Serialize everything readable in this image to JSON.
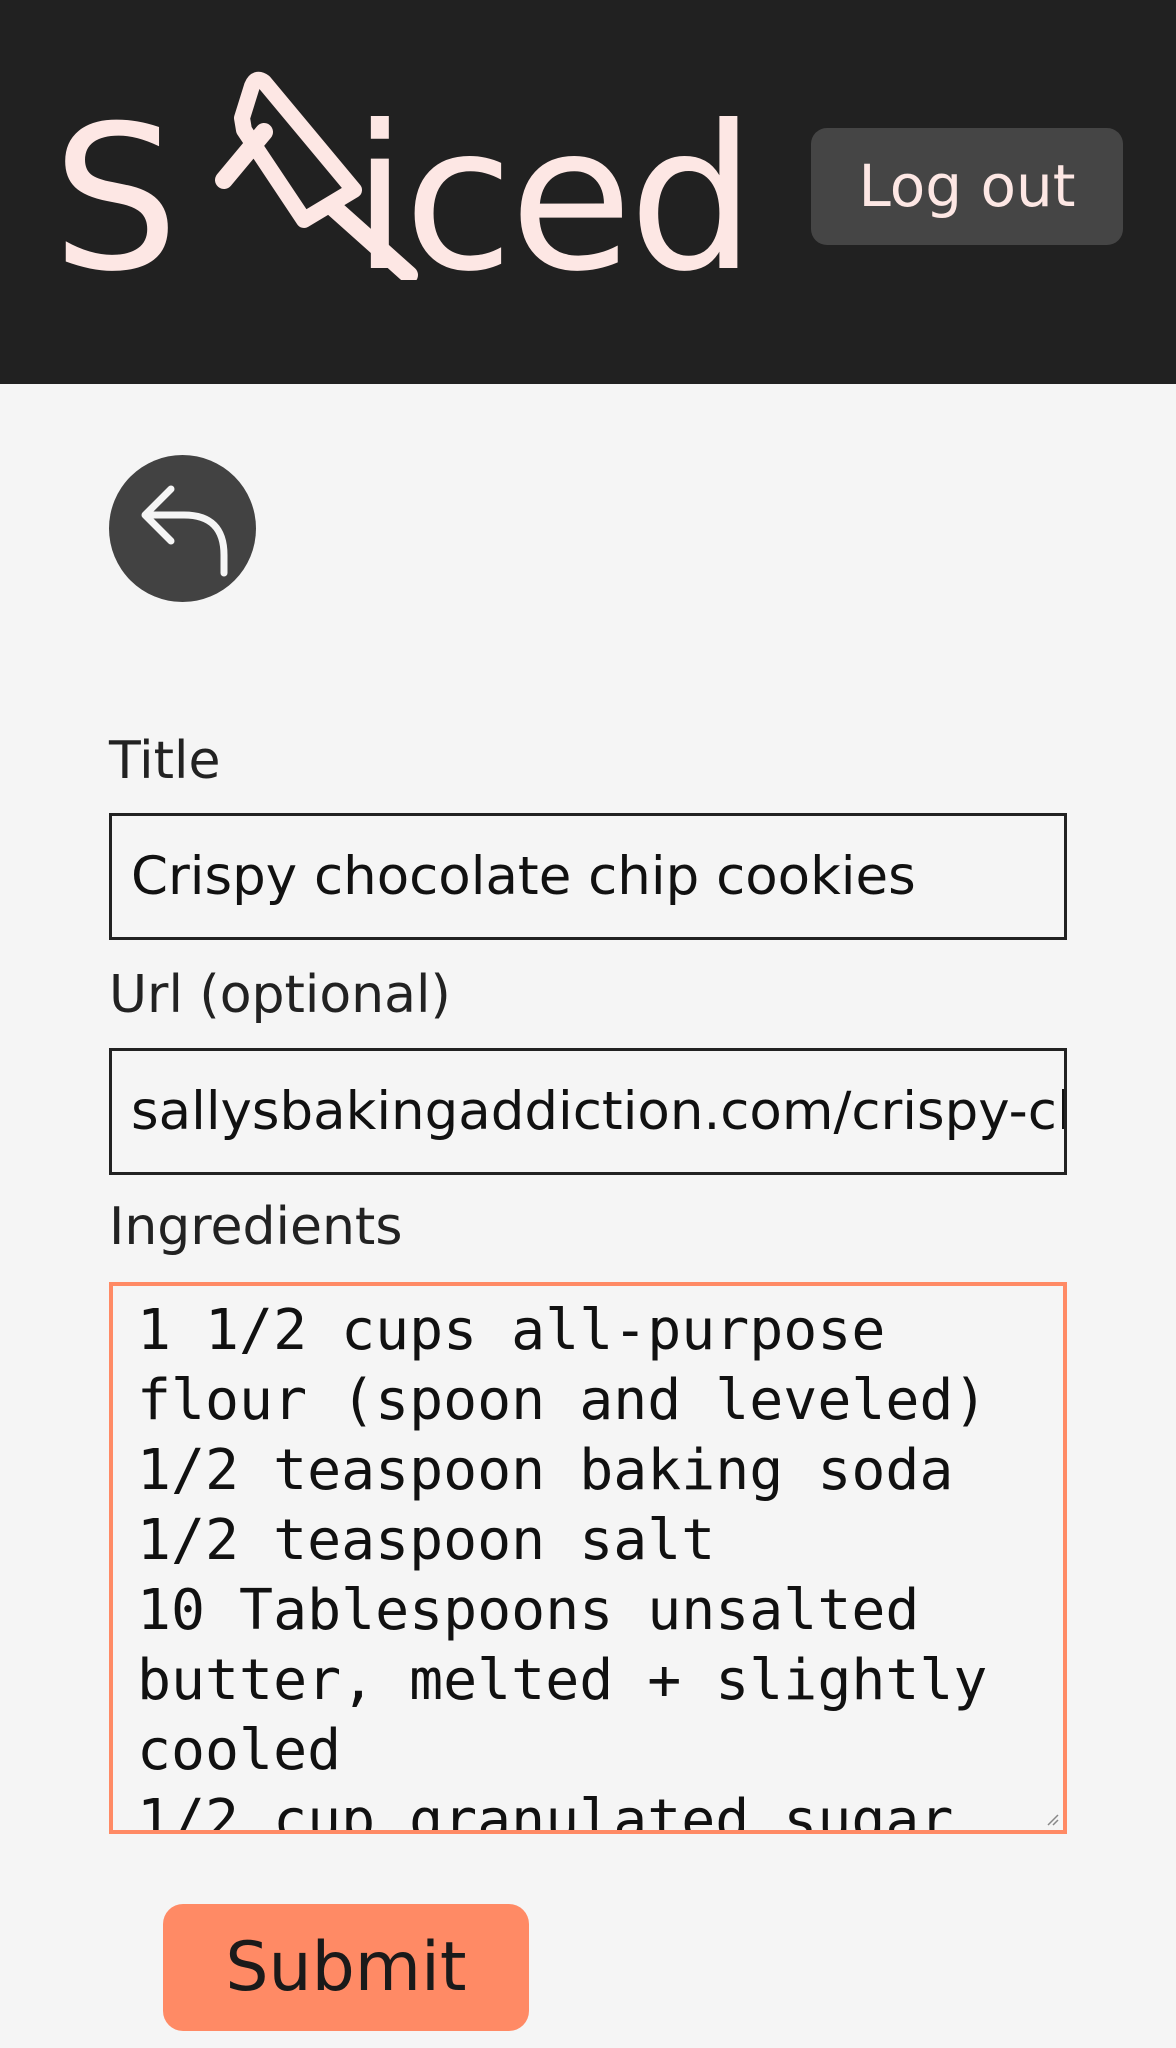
{
  "header": {
    "logo_first": "S",
    "logo_rest": "iced",
    "logout_label": "Log out",
    "logo_color": "#fde7e4",
    "background": "#212121"
  },
  "back_button": {
    "icon": "back-arrow-icon"
  },
  "form": {
    "title_label": "Title",
    "title_value": "Crispy chocolate chip cookies",
    "url_label": "Url (optional)",
    "url_value": "sallysbakingaddiction.com/crispy-cl",
    "ingredients_label": "Ingredients",
    "ingredients_value": "1 1/2 cups all-purpose\nflour (spoon and leveled)\n1/2 teaspoon baking soda\n1/2 teaspoon salt\n10 Tablespoons unsalted\nbutter, melted + slightly\ncooled\n1/2 cup granulated sugar",
    "submit_label": "Submit",
    "accent_color": "#ff8a65"
  }
}
